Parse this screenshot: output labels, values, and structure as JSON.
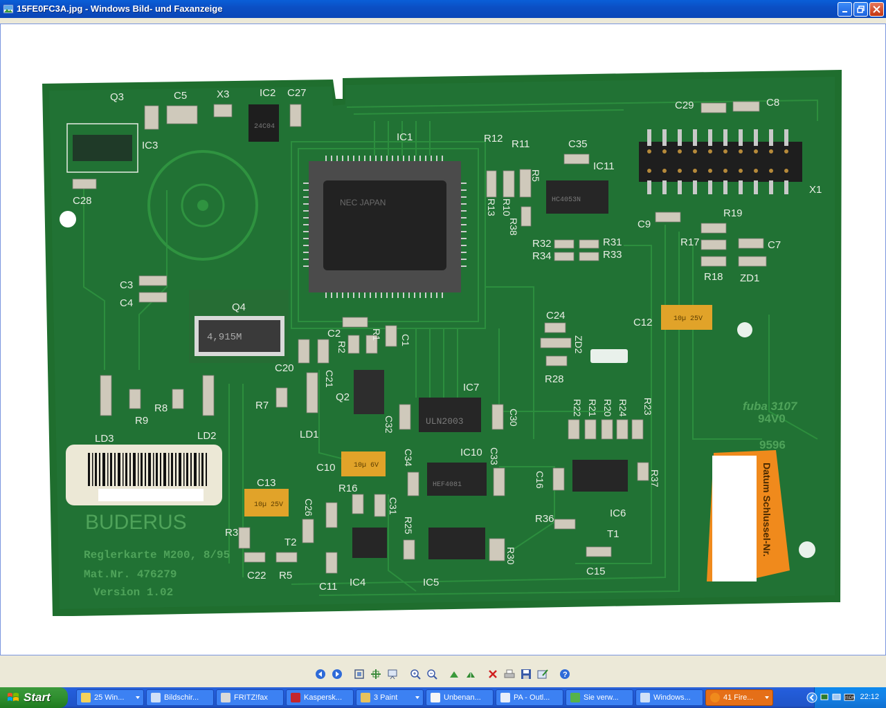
{
  "window": {
    "title": "15FE0FC3A.jpg - Windows Bild- und Faxanzeige",
    "controls": [
      "minimize",
      "restore",
      "close"
    ]
  },
  "board": {
    "labels": {
      "q3": "Q3",
      "c5": "C5",
      "x3": "X3",
      "ic2": "IC2",
      "c27": "C27",
      "ic3": "IC3",
      "c28": "C28",
      "ic1": "IC1",
      "r12": "R12",
      "r11": "R11",
      "c35": "C35",
      "ic11": "IC11",
      "c29": "C29",
      "c8": "C8",
      "x1": "X1",
      "r13": "R13",
      "r10": "R10",
      "r38": "R38",
      "r5": "R5",
      "c9": "C9",
      "r19": "R19",
      "r17": "R17",
      "c7": "C7",
      "r32": "R32",
      "r31": "R31",
      "r34": "R34",
      "r33": "R33",
      "r18": "R18",
      "zd1": "ZD1",
      "c3": "C3",
      "c4": "C4",
      "q4": "Q4",
      "c24": "C24",
      "zd2": "ZD2",
      "c12": "C12",
      "c2": "C2",
      "r1": "R1",
      "c1": "C1",
      "r2": "R2",
      "r28": "R28",
      "c20": "C20",
      "c21": "C21",
      "q2": "Q2",
      "ic7": "IC7",
      "r7": "R7",
      "r8": "R8",
      "r9": "R9",
      "ld3": "LD3",
      "ld2": "LD2",
      "ld1": "LD1",
      "c32": "C32",
      "c30": "C30",
      "r22": "R22",
      "r21": "R21",
      "r20": "R20",
      "r24": "R24",
      "r23": "R23",
      "c10": "C10",
      "c34": "C34",
      "ic10": "IC10",
      "c33": "C33",
      "c16": "C16",
      "r37": "R37",
      "c13": "C13",
      "r16": "R16",
      "c26": "C26",
      "c31": "C31",
      "r25": "R25",
      "r36": "R36",
      "ic6": "IC6",
      "t1": "T1",
      "r3": "R3",
      "t2": "T2",
      "c22": "C22",
      "r5b": "R5",
      "c11": "C11",
      "ic4": "IC4",
      "ic5": "IC5",
      "r30": "R30",
      "c15": "C15"
    },
    "chip_text": {
      "ic2": "24C04",
      "ic1": "NEC JAPAN",
      "ic11": "HC4053N",
      "q4": "4,915M",
      "ic7": "ULN2003",
      "ic10": "HEF4081",
      "c10": "10µ 6V",
      "c12": "10µ 25V",
      "c13": "10µ 25V"
    },
    "brand": "BUDERUS",
    "silkscreen_lines": [
      "Reglerkarte M200, 8/95",
      "Mat.Nr. 476279",
      "Version 1.02"
    ],
    "fuba_lines": [
      "fuba 3107",
      "94V0"
    ],
    "code": "9596",
    "sticker_text": "Datum Schlussel-Nr."
  },
  "toolbar": {
    "tools": [
      "previous-image",
      "next-image",
      "best-fit",
      "actual-size",
      "slideshow",
      "zoom-in",
      "zoom-out",
      "rotate-clockwise",
      "rotate-counterclockwise",
      "delete",
      "print",
      "save",
      "edit",
      "help"
    ]
  },
  "taskbar": {
    "start_label": "Start",
    "tasks": [
      {
        "label": "25 Win...",
        "has_menu": true,
        "active": false
      },
      {
        "label": "Bildschir...",
        "has_menu": false,
        "active": false
      },
      {
        "label": "FRITZ!fax",
        "has_menu": false,
        "active": false
      },
      {
        "label": "Kaspersk...",
        "has_menu": false,
        "active": false
      },
      {
        "label": "3 Paint",
        "has_menu": true,
        "active": false
      },
      {
        "label": "Unbenan...",
        "has_menu": false,
        "active": false
      },
      {
        "label": "PA - Outl...",
        "has_menu": false,
        "active": false
      },
      {
        "label": "Sie verw...",
        "has_menu": false,
        "active": false
      },
      {
        "label": "Windows...",
        "has_menu": false,
        "active": false
      },
      {
        "label": "41 Fire...",
        "has_menu": true,
        "active": true
      }
    ],
    "clock": "22:12"
  },
  "colors": {
    "pcb": "#1F6E2E",
    "pcb_dark": "#155223",
    "trace": "#2E8A3C",
    "silk": "#E8EDE4",
    "chip": "#2B2B2B",
    "sticker": "#F08A1C"
  }
}
